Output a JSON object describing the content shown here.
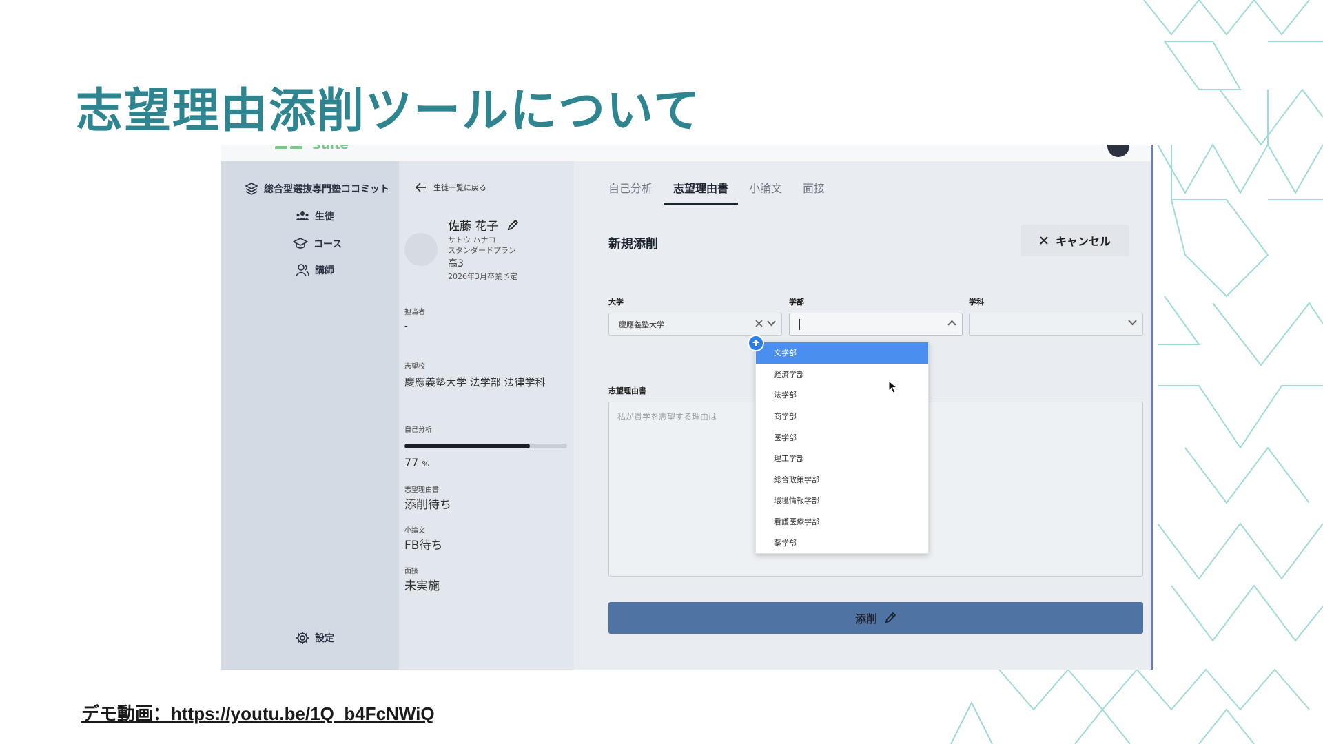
{
  "slide": {
    "title": "志望理由添削ツールについて",
    "demo_link": "デモ動画：https://youtu.be/1Q_b4FcNWiQ"
  },
  "app": {
    "logo_text": "Suite",
    "sidebar": {
      "brand": "総合型選抜専門塾ココミット",
      "items": [
        {
          "label": "生徒",
          "icon": "students-icon"
        },
        {
          "label": "コース",
          "icon": "graduation-cap-icon"
        },
        {
          "label": "講師",
          "icon": "instructor-icon"
        }
      ],
      "settings": "設定"
    },
    "student": {
      "back": "生徒一覧に戻る",
      "name": "佐藤 花子",
      "kana": "サトウ ハナコ",
      "plan": "スタンダードプラン",
      "grade": "高3",
      "graduation": "2026年3月卒業予定",
      "manager_label": "担当者",
      "manager_value": "-",
      "target_label": "志望校",
      "target_value": "慶應義塾大学 法学部 法律学科",
      "self_analysis_label": "自己分析",
      "self_analysis_progress": 77,
      "self_analysis_value": "77",
      "self_analysis_unit": "%",
      "statement_label": "志望理由書",
      "statement_value": "添削待ち",
      "essay_label": "小論文",
      "essay_value": "FB待ち",
      "interview_label": "面接",
      "interview_value": "未実施"
    },
    "main": {
      "tabs": [
        {
          "label": "自己分析",
          "active": false
        },
        {
          "label": "志望理由書",
          "active": true
        },
        {
          "label": "小論文",
          "active": false
        },
        {
          "label": "面接",
          "active": false
        }
      ],
      "section_title": "新規添削",
      "cancel_label": "キャンセル",
      "university_label": "大学",
      "university_value": "慶應義塾大学",
      "faculty_label": "学部",
      "faculty_value": "",
      "department_label": "学科",
      "department_value": "",
      "statement_label": "志望理由書",
      "statement_placeholder": "私が貴学を志望する理由は",
      "submit_label": "添削",
      "faculty_options": [
        "文学部",
        "経済学部",
        "法学部",
        "商学部",
        "医学部",
        "理工学部",
        "総合政策学部",
        "環境情報学部",
        "看護医療学部",
        "薬学部"
      ],
      "faculty_highlighted": "文学部"
    }
  },
  "colors": {
    "title": "#2e8590",
    "decor": "#8fd3d3",
    "submit": "#4f73a3",
    "highlight": "#4a8ff0"
  }
}
